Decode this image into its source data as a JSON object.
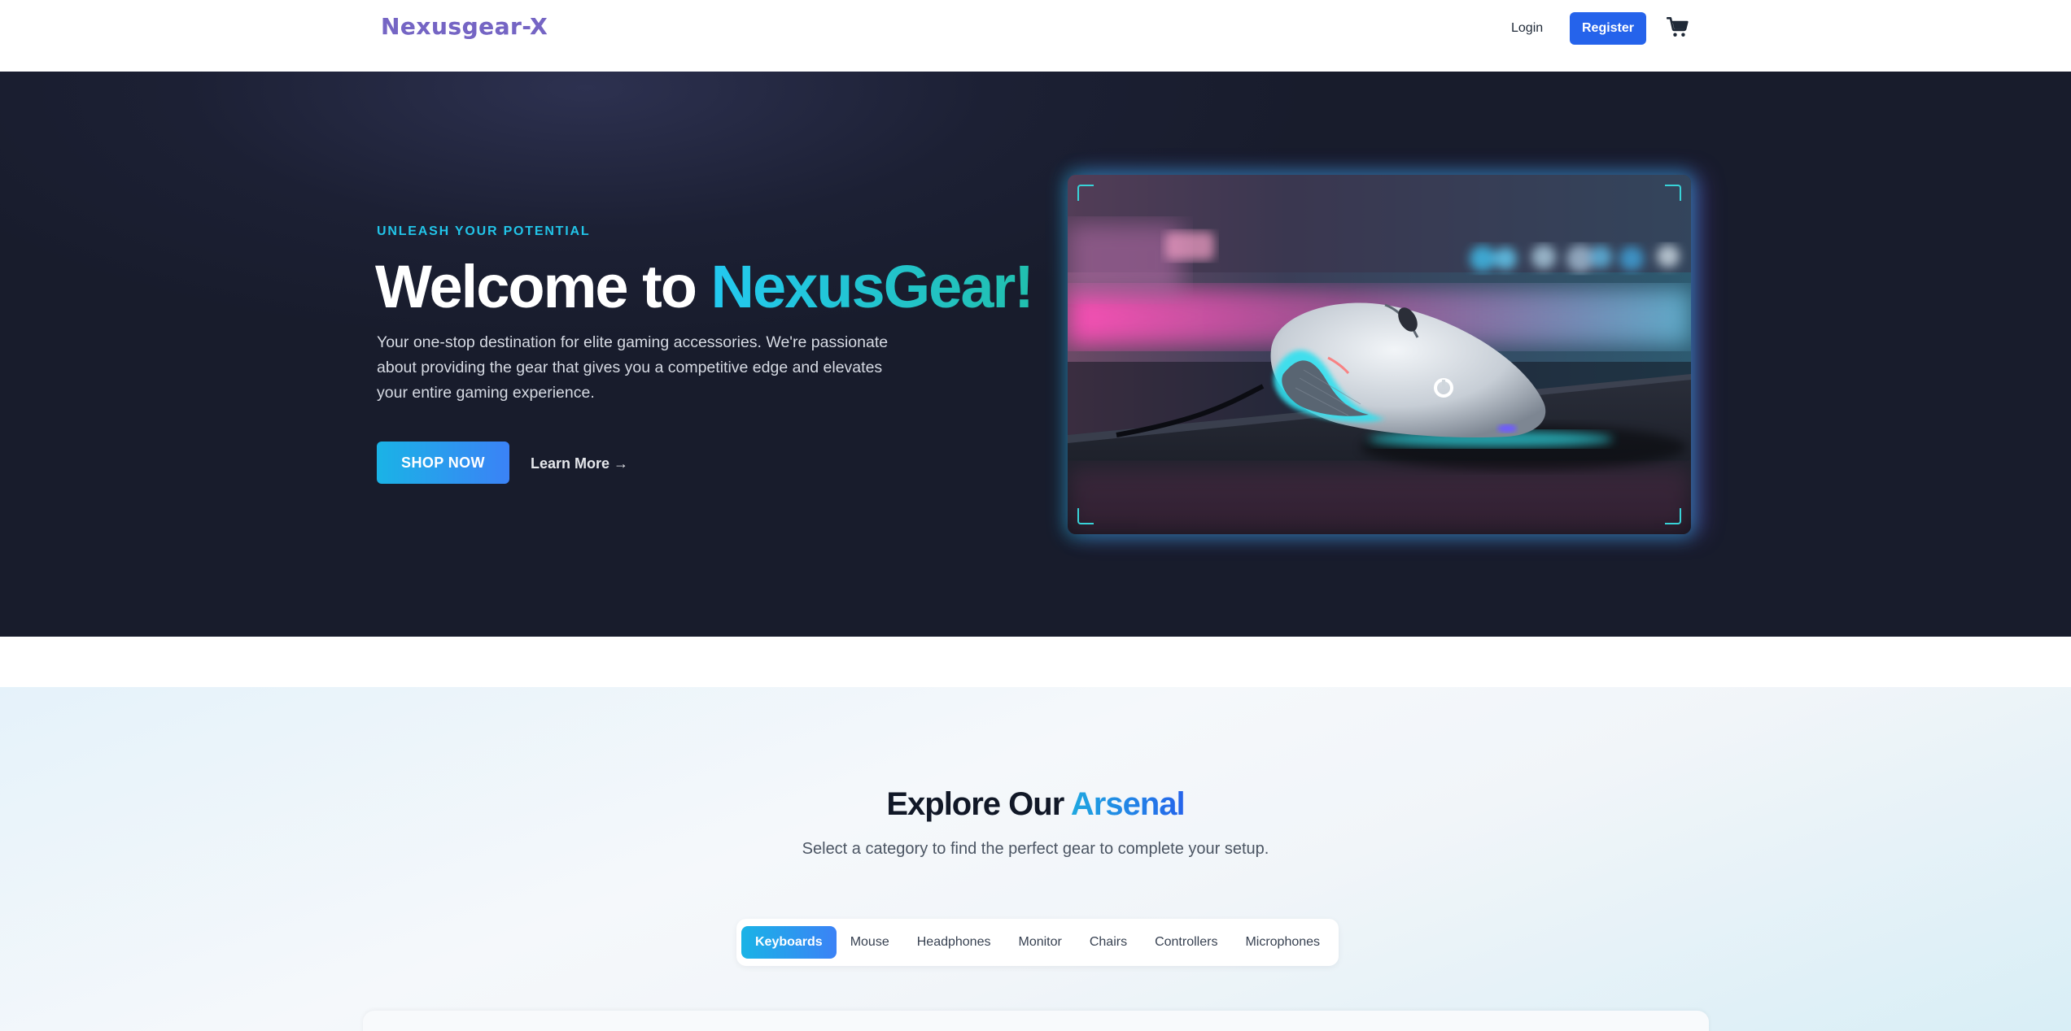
{
  "navbar": {
    "logo": "Nexusgear-X",
    "login_label": "Login",
    "register_label": "Register",
    "cart_icon": "shopping-cart-icon"
  },
  "hero": {
    "eyebrow": "UNLEASH YOUR POTENTIAL",
    "title_prefix": "Welcome to ",
    "title_accent": "NexusGear!",
    "description": "Your one-stop destination for elite gaming accessories. We're passionate about providing the gear that gives you a competitive edge and elevates your entire gaming experience.",
    "shop_button": "SHOP NOW",
    "learn_more": "Learn More →",
    "image_subject": "RGB gaming mouse on mousepad"
  },
  "explore": {
    "title_prefix": "Explore Our ",
    "title_accent": "Arsenal",
    "subtitle": "Select a category to find the perfect gear to complete your setup.",
    "tabs": [
      "Keyboards",
      "Mouse",
      "Headphones",
      "Monitor",
      "Chairs",
      "Controllers",
      "Microphones"
    ],
    "active_tab": "Keyboards"
  },
  "colors": {
    "accent_cyan": "#22c4e8",
    "brand_blue": "#2563eb",
    "hero_bg": "#1c2034",
    "logo_purple": "#7565c4"
  }
}
